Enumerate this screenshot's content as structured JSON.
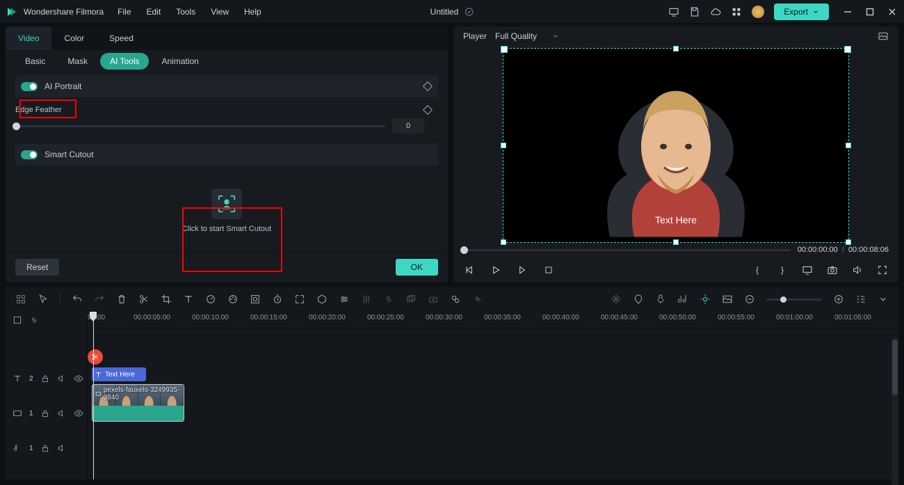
{
  "app": {
    "name": "Wondershare Filmora",
    "project_title": "Untitled"
  },
  "menubar": [
    "File",
    "Edit",
    "Tools",
    "View",
    "Help"
  ],
  "export": {
    "label": "Export"
  },
  "tabs_top": {
    "video": "Video",
    "color": "Color",
    "speed": "Speed"
  },
  "tabs_sub": [
    "Basic",
    "Mask",
    "AI Tools",
    "Animation"
  ],
  "ai_tools": {
    "ai_portrait": {
      "label": "AI Portrait"
    },
    "edge_feather": {
      "label": "Edge Feather",
      "value": "0"
    },
    "smart_cutout": {
      "label": "Smart Cutout",
      "cta": "Click to start Smart Cutout"
    }
  },
  "buttons": {
    "reset": "Reset",
    "ok": "OK"
  },
  "player": {
    "label": "Player",
    "quality": "Full Quality",
    "overlay_text": "Text Here",
    "time_current": "00:00:00:00",
    "time_total": "00:00:08:06"
  },
  "timeline": {
    "ticks": [
      "00:00",
      "00:00:05:00",
      "00:00:10:00",
      "00:00:15:00",
      "00:00:20:00",
      "00:00:25:00",
      "00:00:30:00",
      "00:00:35:00",
      "00:00:40:00",
      "00:00:45:00",
      "00:00:50:00",
      "00:00:55:00",
      "00:01:00:00",
      "00:01:05:00"
    ],
    "text_clip_label": "Text Here",
    "video_clip_label": "pexels-fauxels-3249935-3840",
    "tracks": {
      "t2": "2",
      "t1": "1",
      "a1": "1"
    }
  }
}
